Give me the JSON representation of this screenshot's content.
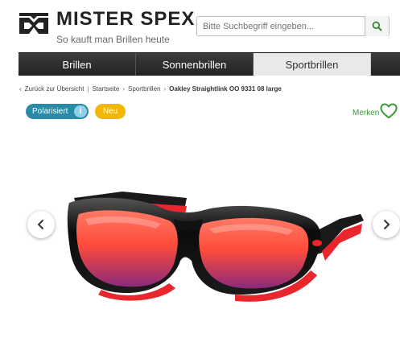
{
  "header": {
    "brand": "MISTER SPEX",
    "tagline": "So kauft man Brillen heute",
    "logo_icon": "mister-spex-logo-icon"
  },
  "search": {
    "placeholder": "Bitte Suchbegriff eingeben...",
    "button_icon": "search-icon"
  },
  "nav": {
    "tabs": [
      {
        "label": "Brillen"
      },
      {
        "label": "Sonnenbrillen"
      },
      {
        "label": "Sportbrillen"
      },
      {
        "label": ""
      }
    ],
    "active": "Sportbrillen"
  },
  "breadcrumb": {
    "back": "Zurück zur Übersicht",
    "items": [
      "Startseite",
      "Sportbrillen",
      "Oakley Straightlink OO 9331 08 large"
    ]
  },
  "badges": {
    "polarized": "Polarisiert",
    "polarized_info": "i",
    "new": "Neu"
  },
  "wishlist": {
    "label": "Merken",
    "icon": "heart-icon"
  },
  "carousel": {
    "prev_icon": "chevron-left-icon",
    "next_icon": "chevron-right-icon"
  },
  "colors": {
    "nav_dark": "#2b2b2b",
    "nav_active": "#e9e9e9",
    "badge_polarized": "#2a8aa8",
    "badge_new": "#f2b705",
    "accent_green": "#3a9a3a"
  }
}
